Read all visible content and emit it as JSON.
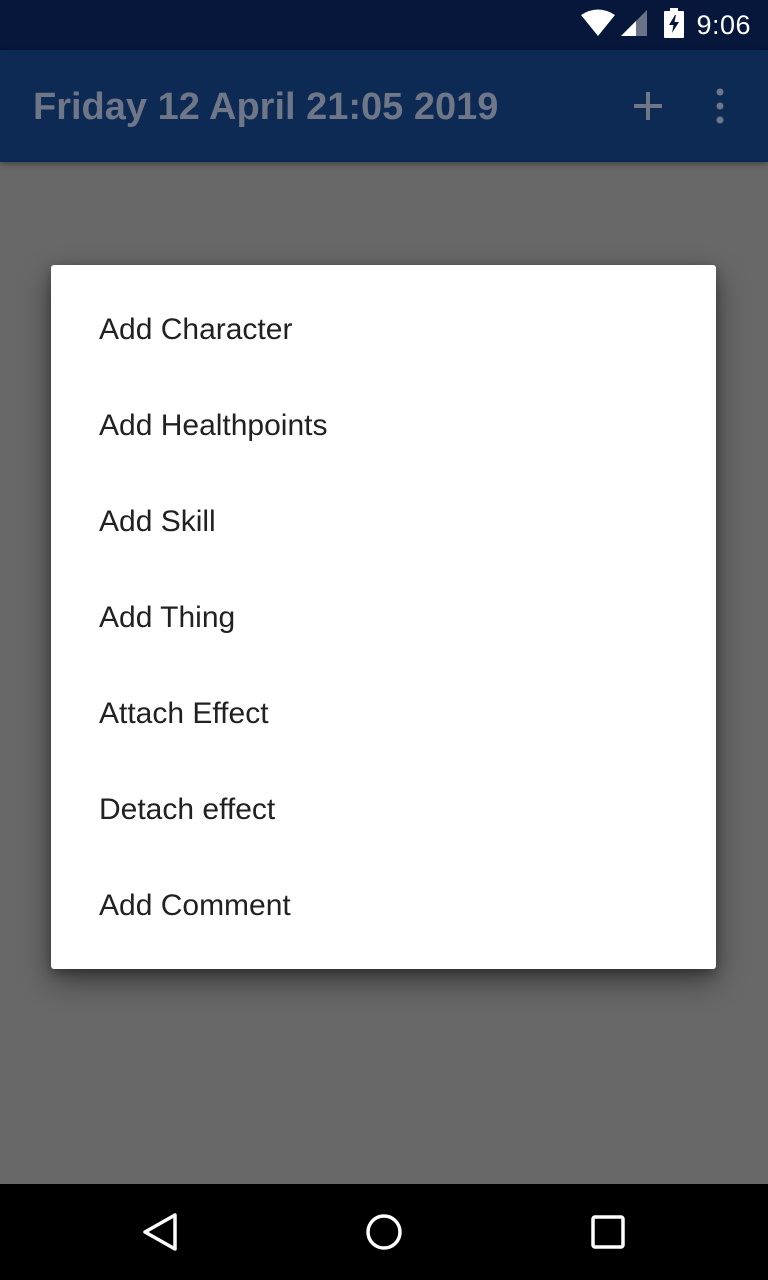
{
  "status_bar": {
    "time": "9:06",
    "icons": [
      "wifi-icon",
      "cell-signal-icon",
      "battery-charging-icon"
    ]
  },
  "toolbar": {
    "title": "Friday 12 April 21:05 2019",
    "actions": [
      "add-icon",
      "more-vert-icon"
    ]
  },
  "dialog": {
    "items": [
      {
        "label": "Add Character"
      },
      {
        "label": "Add Healthpoints"
      },
      {
        "label": "Add Skill"
      },
      {
        "label": "Add Thing"
      },
      {
        "label": "Attach Effect"
      },
      {
        "label": "Detach effect"
      },
      {
        "label": "Add Comment"
      }
    ]
  },
  "nav_bar": {
    "buttons": [
      "back-icon",
      "home-icon",
      "recents-icon"
    ]
  },
  "colors": {
    "status_bar": "#06173b",
    "toolbar": "#0c2a54",
    "scrim_background": "#686868",
    "dialog": "#ffffff",
    "menu_text": "#212121"
  }
}
